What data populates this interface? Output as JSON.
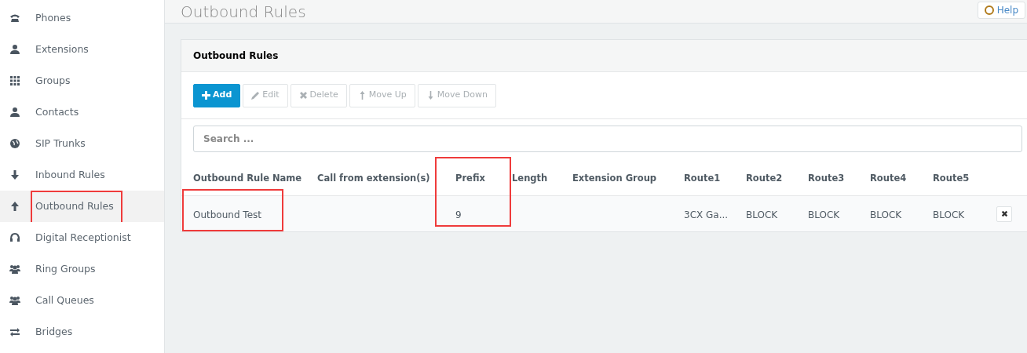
{
  "sidebar": {
    "items": [
      {
        "label": "Phones",
        "selected": false,
        "highlighted": false
      },
      {
        "label": "Extensions",
        "selected": false,
        "highlighted": false
      },
      {
        "label": "Groups",
        "selected": false,
        "highlighted": false
      },
      {
        "label": "Contacts",
        "selected": false,
        "highlighted": false
      },
      {
        "label": "SIP Trunks",
        "selected": false,
        "highlighted": false
      },
      {
        "label": "Inbound Rules",
        "selected": false,
        "highlighted": false
      },
      {
        "label": "Outbound Rules",
        "selected": true,
        "highlighted": true
      },
      {
        "label": "Digital Receptionist",
        "selected": false,
        "highlighted": false
      },
      {
        "label": "Ring Groups",
        "selected": false,
        "highlighted": false
      },
      {
        "label": "Call Queues",
        "selected": false,
        "highlighted": false
      },
      {
        "label": "Bridges",
        "selected": false,
        "highlighted": false
      }
    ]
  },
  "page_title": "Outbound Rules",
  "help_button": "Help",
  "panel": {
    "title": "Outbound Rules",
    "toolbar": [
      {
        "label": "Add",
        "disabled": false
      },
      {
        "label": "Edit",
        "disabled": true
      },
      {
        "label": "Delete",
        "disabled": true
      },
      {
        "label": "Move Up",
        "disabled": true
      },
      {
        "label": "Move Down",
        "disabled": true
      }
    ],
    "search": {
      "placeholder": "Search ..."
    },
    "table": {
      "columns": [
        {
          "label": "Outbound Rule Name",
          "highlighted": false
        },
        {
          "label": "Call from extension(s)",
          "highlighted": false
        },
        {
          "label": "Prefix",
          "highlighted": true
        },
        {
          "label": "Length",
          "highlighted": false
        },
        {
          "label": "Extension Group",
          "highlighted": false
        },
        {
          "label": "Route1",
          "highlighted": false
        },
        {
          "label": "Route2",
          "highlighted": false
        },
        {
          "label": "Route3",
          "highlighted": false
        },
        {
          "label": "Route4",
          "highlighted": false
        },
        {
          "label": "Route5",
          "highlighted": false
        }
      ],
      "rows": [
        {
          "name_highlighted": true,
          "cells": [
            "Outbound Test",
            null,
            "9",
            null,
            null,
            "3CX Ga...",
            "BLOCK",
            "BLOCK",
            "BLOCK",
            "BLOCK"
          ]
        }
      ]
    }
  }
}
